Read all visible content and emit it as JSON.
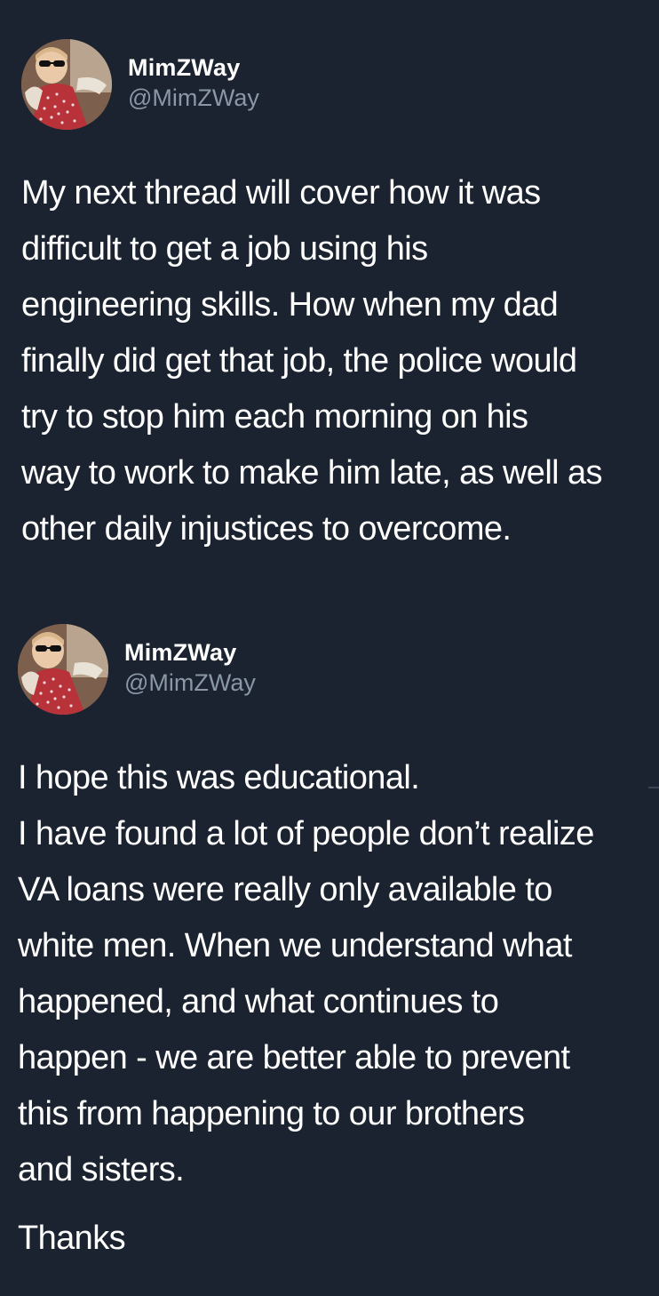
{
  "tweets": [
    {
      "author": {
        "display_name": "MimZWay",
        "handle": "@MimZWay",
        "avatar_icon": "profile-photo-child-sunglasses"
      },
      "lines": [
        "My next thread will cover how it was",
        "difficult to get a job using his",
        "engineering skills. How when my dad",
        "finally did get that job, the police would",
        "try to stop him each morning on his",
        "way to work to make him late, as well as",
        "other daily injustices to overcome."
      ]
    },
    {
      "author": {
        "display_name": "MimZWay",
        "handle": "@MimZWay",
        "avatar_icon": "profile-photo-child-sunglasses"
      },
      "lines": [
        "I hope this was educational.",
        "I have found a lot of people don’t realize",
        "VA loans were really only available to",
        "white men. When we understand what",
        "happened, and what continues to",
        "happen - we are better able to prevent",
        "this from happening to our brothers",
        "and sisters."
      ],
      "closing": "Thanks"
    }
  ],
  "colors": {
    "background": "#1b2230",
    "text": "#ffffff",
    "handle": "#8a97a6"
  }
}
